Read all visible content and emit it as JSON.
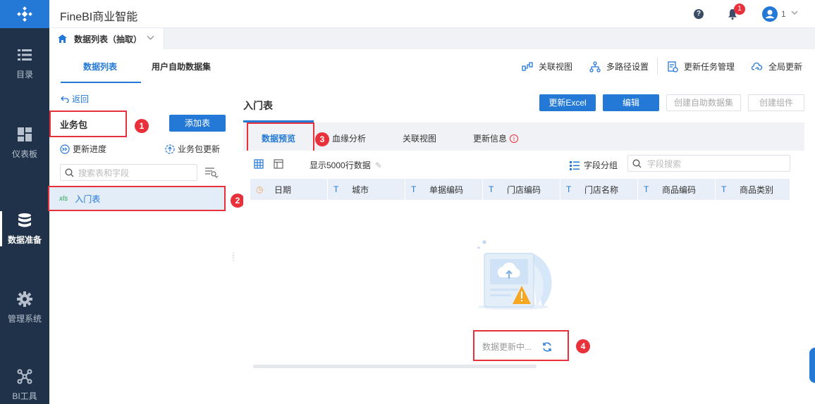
{
  "app": {
    "brand": "FineBI商业智能",
    "user_name": "1",
    "notification_count": "1"
  },
  "rail": {
    "items": [
      {
        "label": "目录",
        "icon": "list-icon"
      },
      {
        "label": "仪表板",
        "icon": "dashboard-icon"
      },
      {
        "label": "数据准备",
        "icon": "database-icon",
        "active": true
      },
      {
        "label": "管理系统",
        "icon": "gear-icon"
      },
      {
        "label": "BI工具",
        "icon": "tools-icon"
      }
    ]
  },
  "tabstrip": {
    "tab_label": "数据列表（抽取）"
  },
  "subnav": {
    "tabs": [
      "数据列表",
      "用户自助数据集"
    ],
    "actions": [
      "关联视图",
      "多路径设置",
      "更新任务管理",
      "全局更新"
    ]
  },
  "package": {
    "back_label": "返回",
    "title": "业务包",
    "add_table_label": "添加表",
    "update_progress_label": "更新进度",
    "update_package_label": "业务包更新",
    "search_placeholder": "搜索表和字段",
    "table_item": {
      "type_badge": "xls",
      "name": "入门表"
    }
  },
  "content": {
    "title": "入门表",
    "buttons": [
      "更新Excel",
      "编辑",
      "创建自助数据集",
      "创建组件"
    ],
    "tabs": [
      "数据预览",
      "血缘分析",
      "关联视图",
      "更新信息"
    ],
    "preview": {
      "show_rows_label": "显示5000行数据",
      "group_field_label": "字段分组",
      "field_search_placeholder": "字段搜索",
      "columns": [
        {
          "name": "日期",
          "type": "date"
        },
        {
          "name": "城市",
          "type": "text"
        },
        {
          "name": "单据编码",
          "type": "text"
        },
        {
          "name": "门店编码",
          "type": "text"
        },
        {
          "name": "门店名称",
          "type": "text"
        },
        {
          "name": "商品编码",
          "type": "text"
        },
        {
          "name": "商品类别",
          "type": "text"
        }
      ],
      "loading_text": "数据更新中..."
    }
  },
  "annotations": [
    "1",
    "2",
    "3",
    "4"
  ],
  "colors": {
    "accent": "#2479d6",
    "rail": "#20324a",
    "highlight": "#e8313a"
  }
}
